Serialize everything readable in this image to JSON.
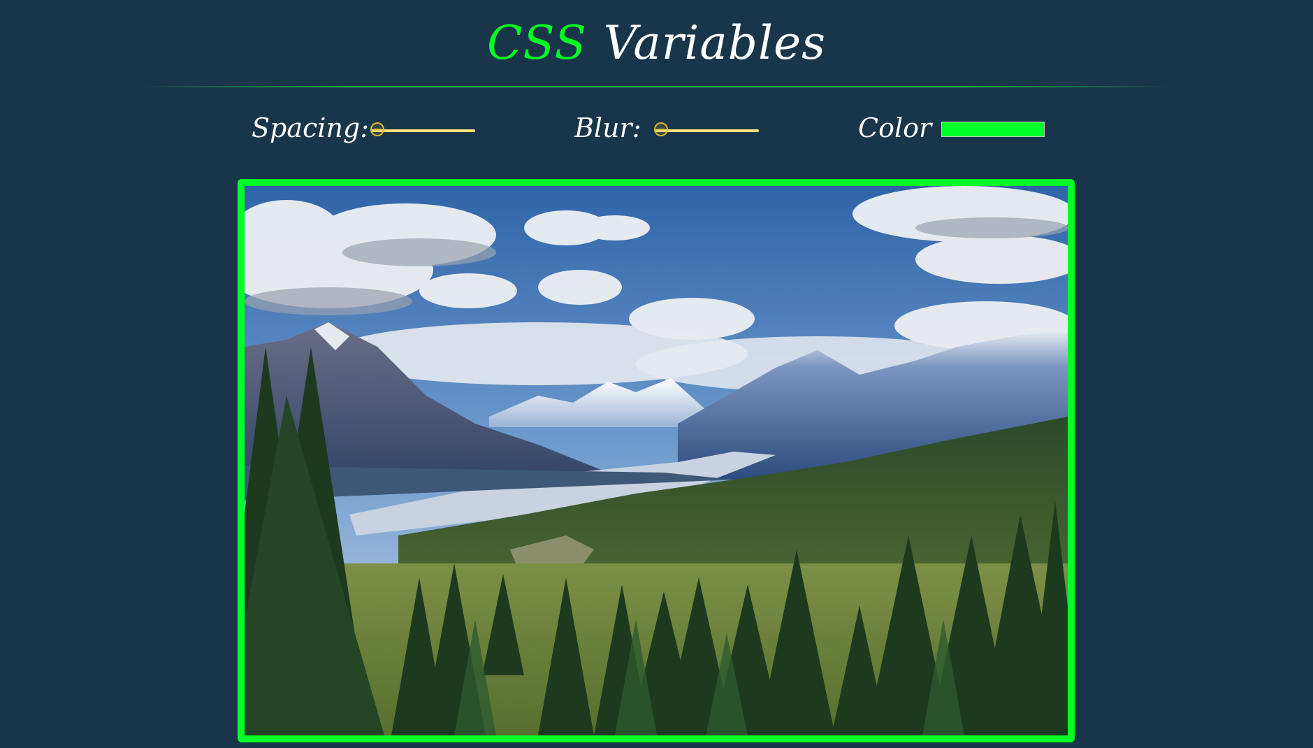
{
  "header": {
    "title_highlight": "CSS",
    "title_rest": "Variables"
  },
  "controls": {
    "spacing": {
      "label": "Spacing:",
      "value_fraction": 0.0
    },
    "blur": {
      "label": "Blur:",
      "value_fraction": 0.0
    },
    "color": {
      "label": "Color",
      "value": "#00ff26"
    }
  },
  "colors": {
    "background": "#193549",
    "accent": "#00ff26",
    "slider_track": "#f5e27a",
    "slider_thumb": "#e0b52a"
  },
  "image": {
    "icon": "mountain-landscape-photo"
  }
}
